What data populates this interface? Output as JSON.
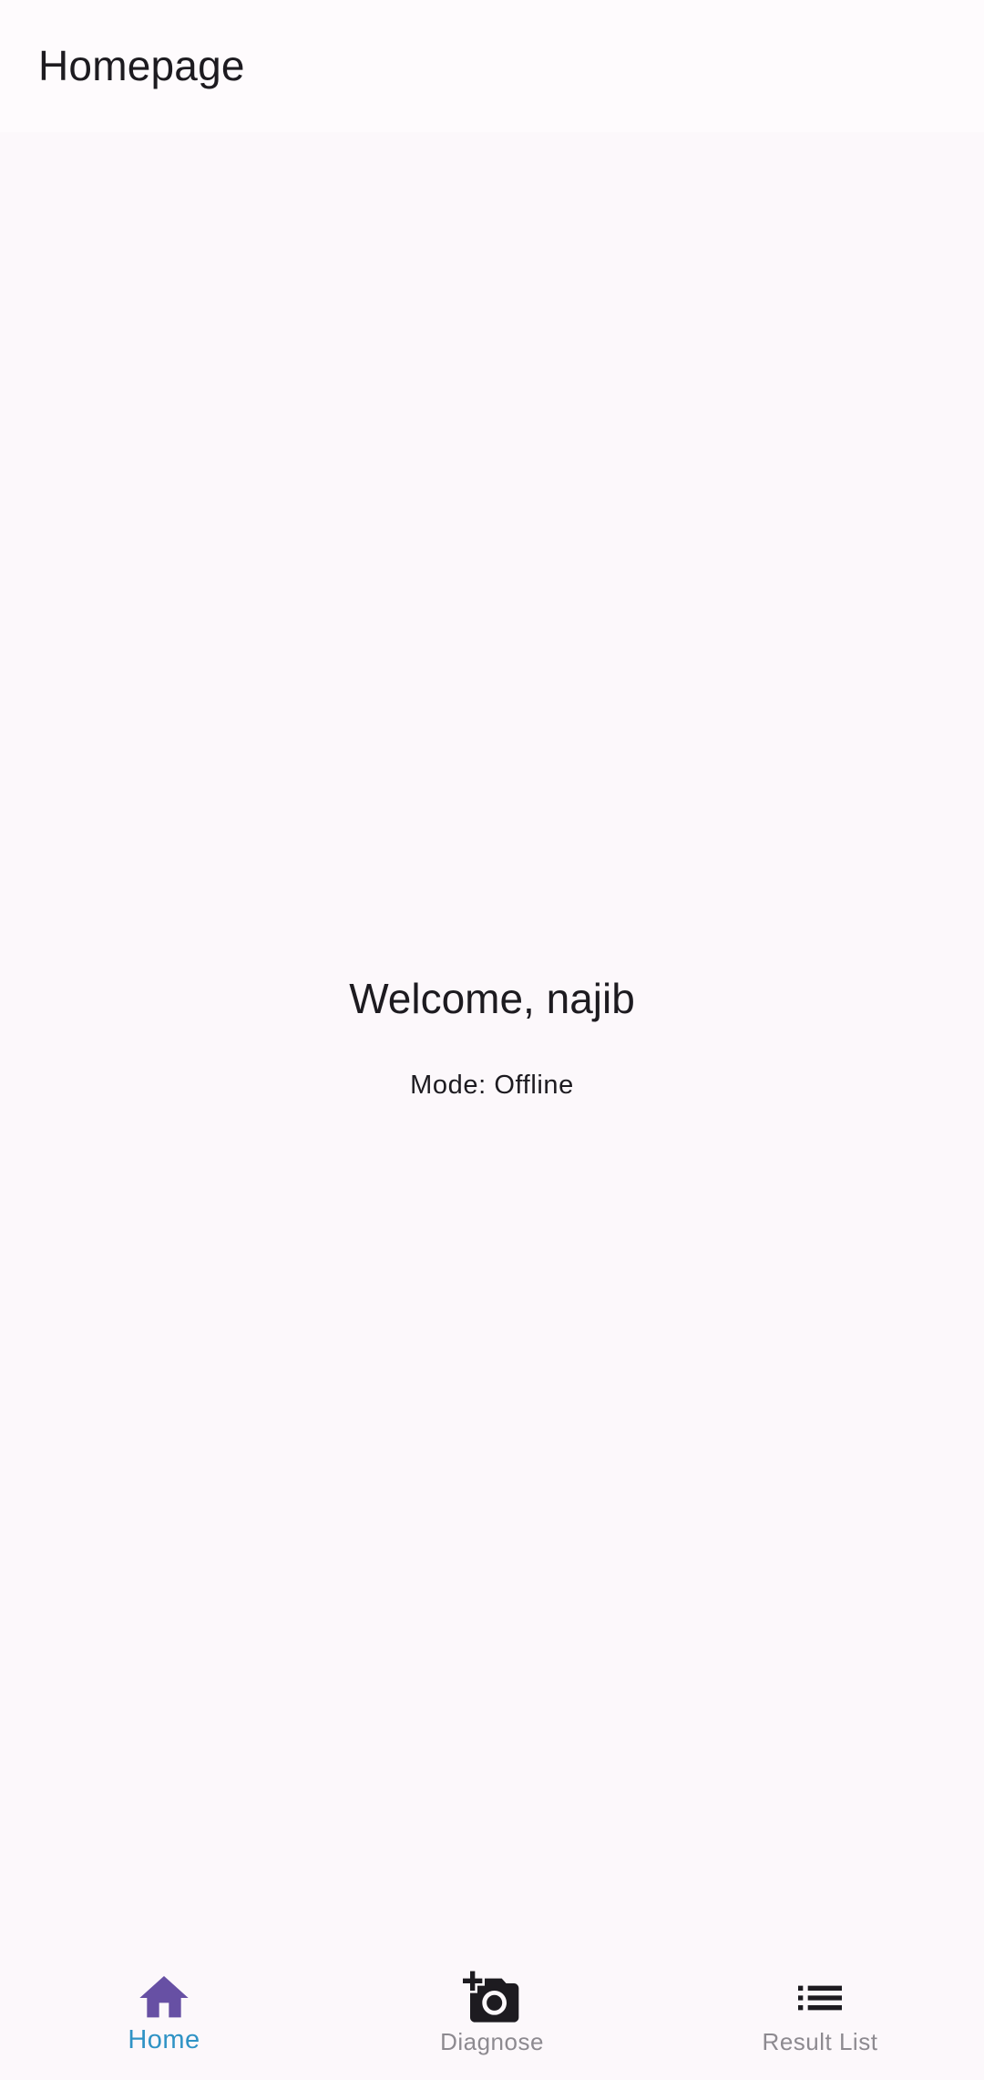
{
  "app_bar": {
    "title": "Homepage"
  },
  "main": {
    "welcome_text": "Welcome, najib",
    "mode_text": "Mode: Offline"
  },
  "bottom_nav": {
    "items": [
      {
        "label": "Home",
        "icon": "home-icon",
        "active": true
      },
      {
        "label": "Diagnose",
        "icon": "add-camera-icon",
        "active": false
      },
      {
        "label": "Result List",
        "icon": "list-icon",
        "active": false
      }
    ]
  },
  "colors": {
    "active_icon": "#6750a4",
    "active_label": "#2f93c5",
    "inactive_icon": "#1d1b20",
    "inactive_label": "#8d8a90",
    "background": "#fcf8fb"
  }
}
